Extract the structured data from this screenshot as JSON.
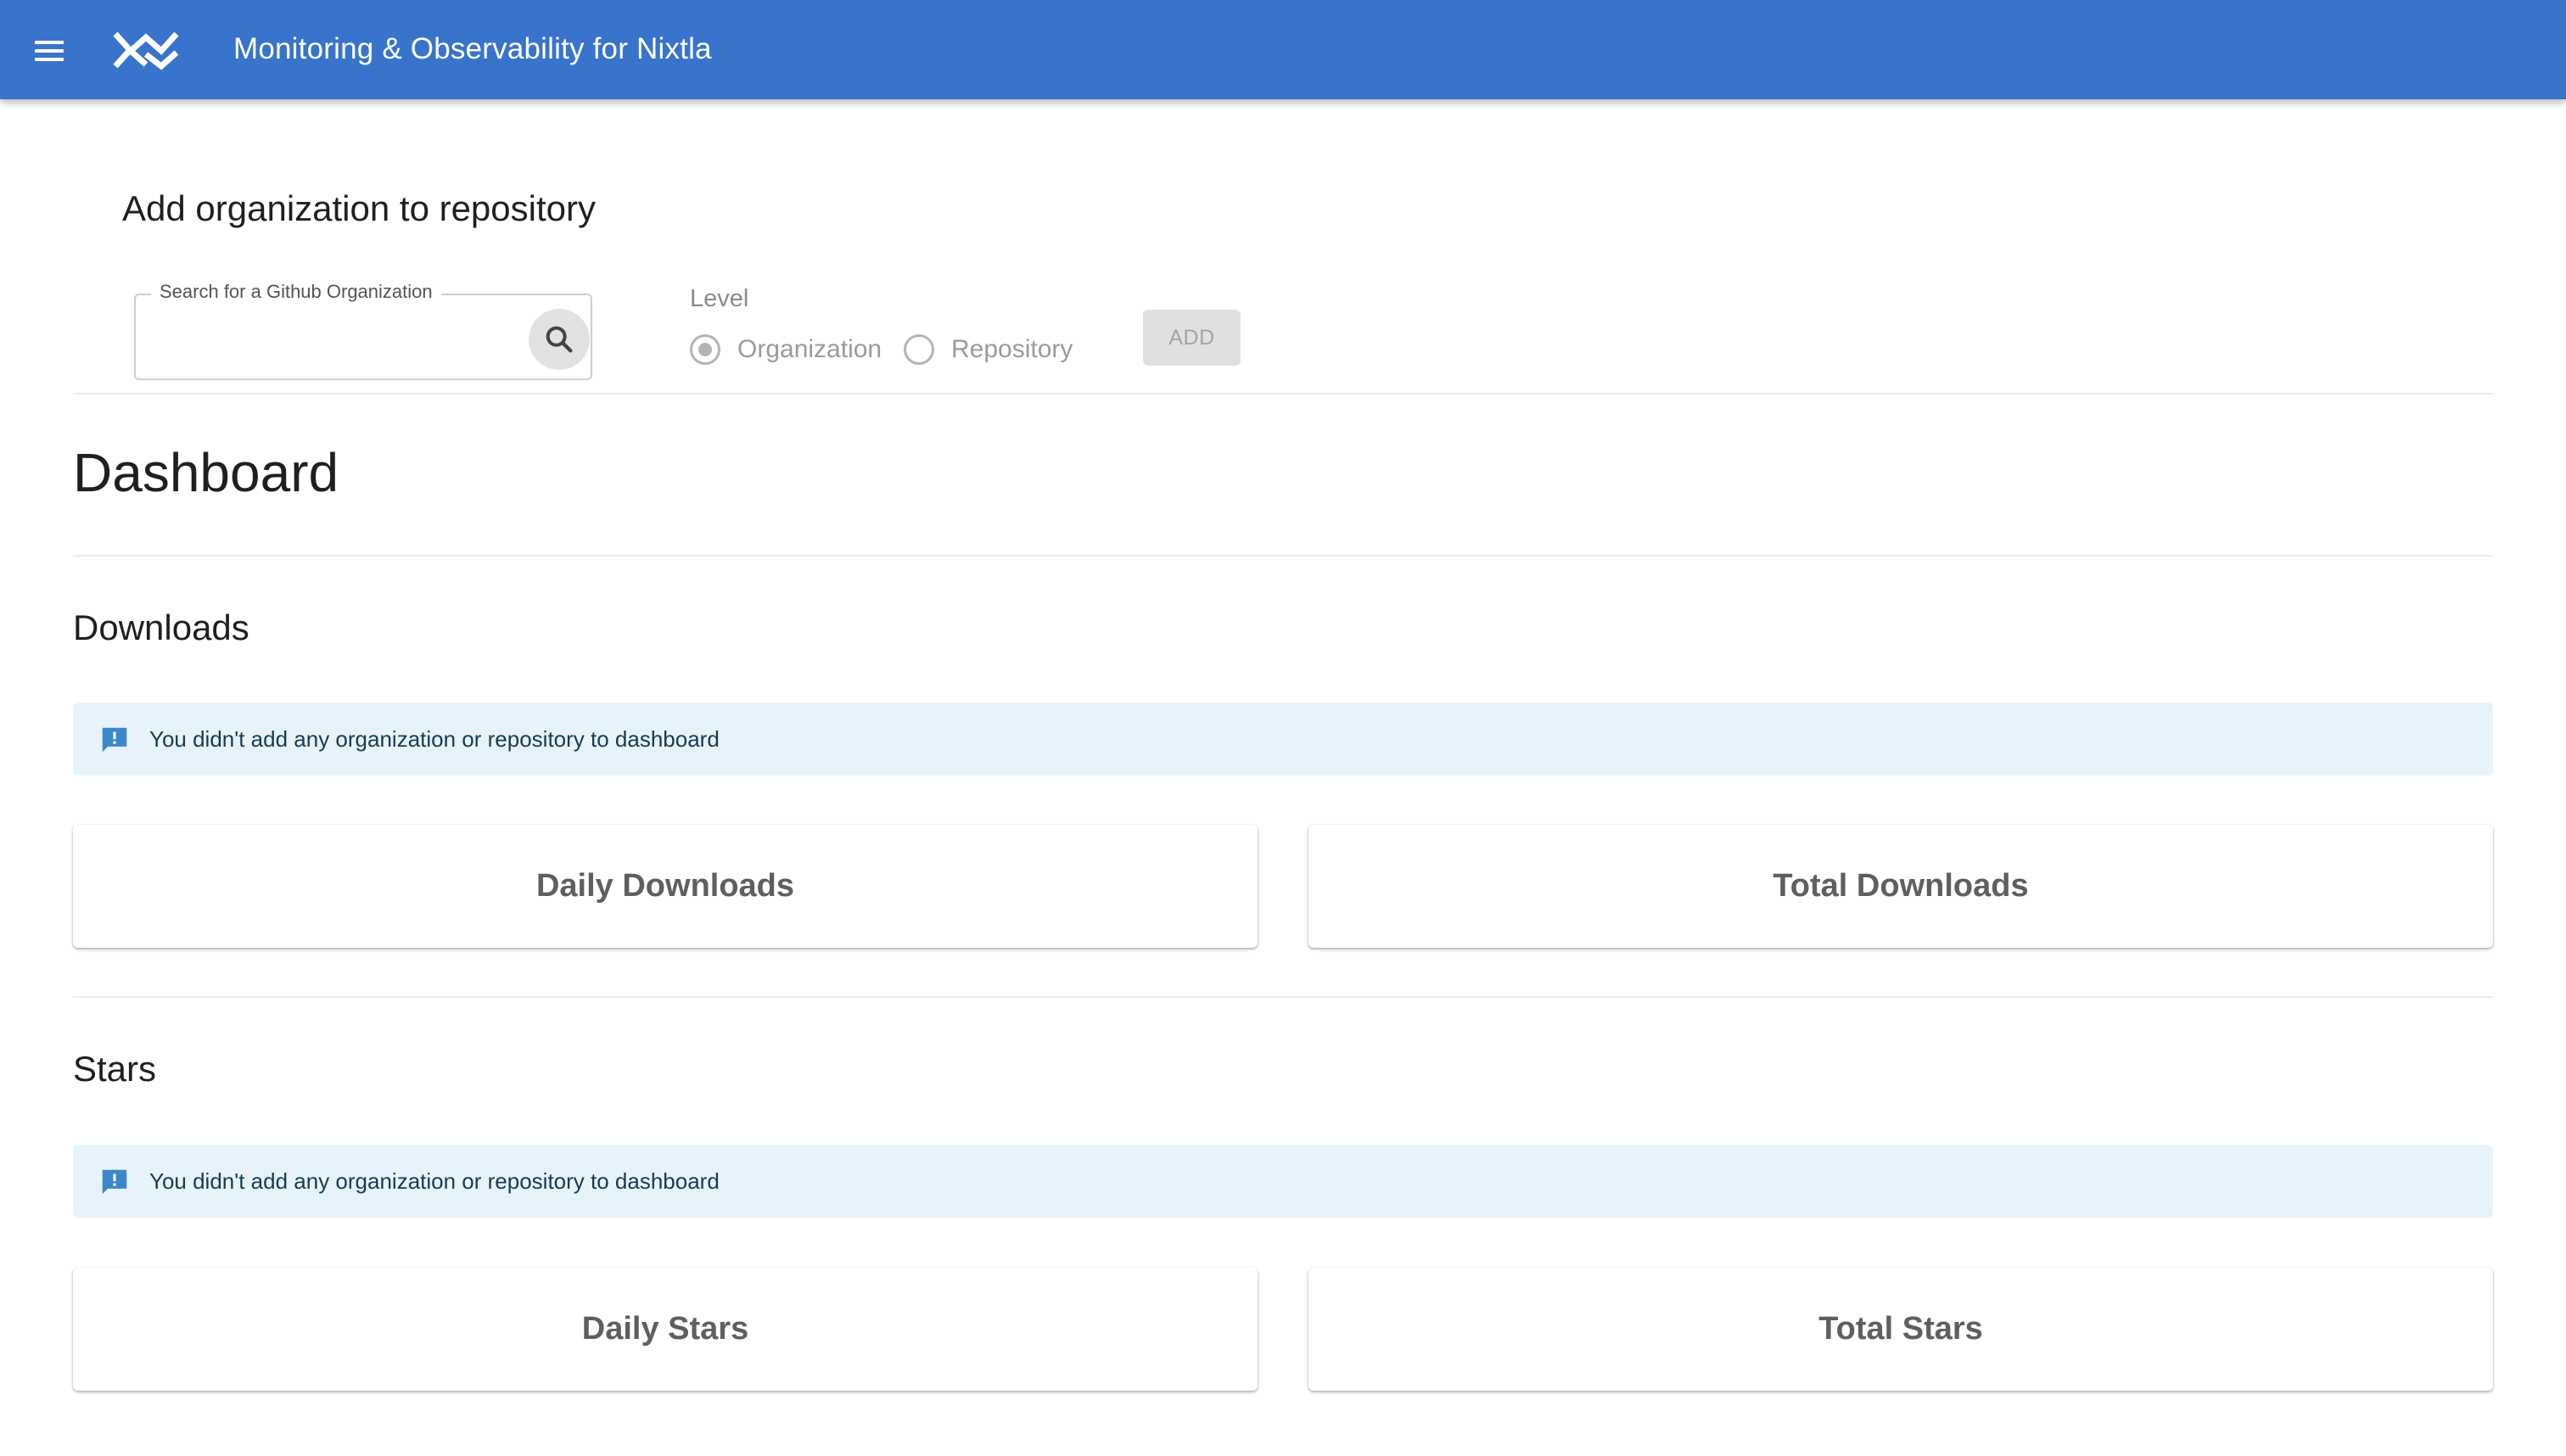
{
  "app": {
    "title": "Monitoring & Observability for Nixtla",
    "menu_icon": "hamburger-menu-icon",
    "logo": "nixtla-logo",
    "brand_color": "#3874cb"
  },
  "add_org": {
    "heading": "Add organization to repository",
    "search": {
      "label": "Search for a Github Organization",
      "value": "",
      "placeholder": "",
      "icon": "search-icon"
    },
    "level": {
      "label": "Level",
      "options": [
        {
          "label": "Organization",
          "selected": true
        },
        {
          "label": "Repository",
          "selected": false
        }
      ]
    },
    "add_button": "ADD"
  },
  "dashboard": {
    "title": "Dashboard",
    "sections": [
      {
        "heading": "Downloads",
        "alert": "You didn't add any organization or repository to dashboard",
        "alert_icon": "feedback-icon",
        "cards": [
          "Daily Downloads",
          "Total Downloads"
        ]
      },
      {
        "heading": "Stars",
        "alert": "You didn't add any organization or repository to dashboard",
        "alert_icon": "feedback-icon",
        "cards": [
          "Daily Stars",
          "Total Stars"
        ]
      }
    ]
  },
  "colors": {
    "alert_bg": "#e6f3fb",
    "alert_icon": "#3b87c8",
    "disabled": "#b3b3b3"
  }
}
